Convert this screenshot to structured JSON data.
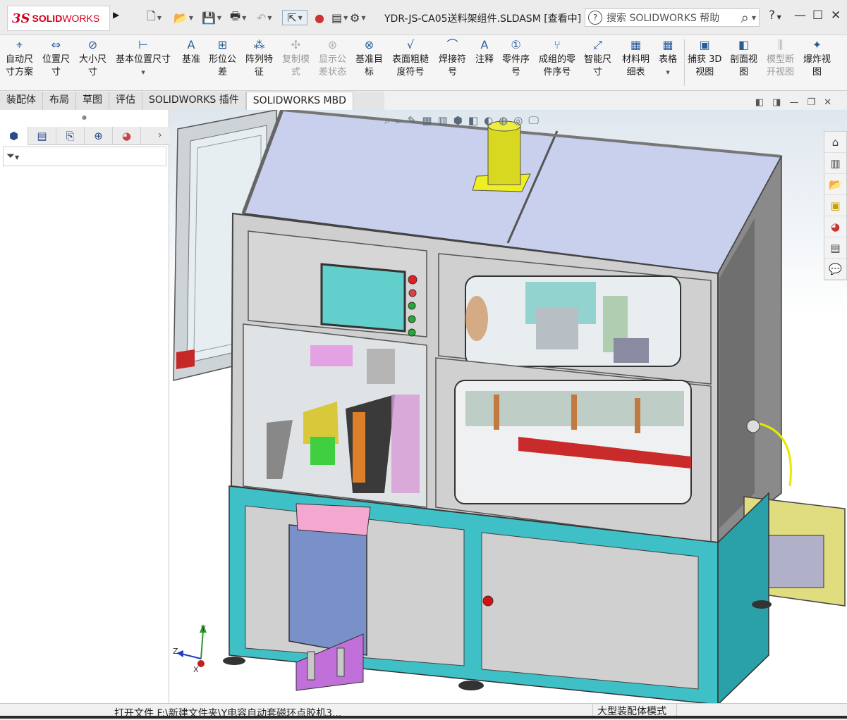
{
  "title": {
    "logo_ds": "3S",
    "logo_solid": "SOLID",
    "logo_works": "WORKS",
    "document": "YDR-JS-CA05送料架组件.SLDASM [查看中]",
    "search_placeholder": "搜索 SOLIDWORKS 帮助",
    "help_label": "?"
  },
  "commands": [
    {
      "label1": "自动尺",
      "label2": "寸方案",
      "icon": "auto-dimension-icon",
      "disabled": false
    },
    {
      "label1": "位置尺",
      "label2": "寸",
      "icon": "location-dimension-icon",
      "disabled": false
    },
    {
      "label1": "大小尺",
      "label2": "寸",
      "icon": "size-dimension-icon",
      "disabled": false
    },
    {
      "label1": "基本位置尺寸",
      "label2": "",
      "icon": "basic-location-dimension-icon",
      "disabled": false
    },
    {
      "label1": "基准",
      "label2": "",
      "icon": "datum-icon",
      "disabled": false
    },
    {
      "label1": "形位公",
      "label2": "差",
      "icon": "geometric-tolerance-icon",
      "disabled": false
    },
    {
      "label1": "阵列特",
      "label2": "征",
      "icon": "pattern-feature-icon",
      "disabled": false
    },
    {
      "label1": "复制模",
      "label2": "式",
      "icon": "copy-scheme-icon",
      "disabled": true
    },
    {
      "label1": "显示公",
      "label2": "差状态",
      "icon": "show-tolerance-status-icon",
      "disabled": true
    },
    {
      "label1": "基准目",
      "label2": "标",
      "icon": "datum-target-icon",
      "disabled": false
    },
    {
      "label1": "表面粗糙",
      "label2": "度符号",
      "icon": "surface-finish-icon",
      "disabled": false
    },
    {
      "label1": "焊接符",
      "label2": "号",
      "icon": "weld-symbol-icon",
      "disabled": false
    },
    {
      "label1": "注释",
      "label2": "",
      "icon": "note-icon",
      "disabled": false
    },
    {
      "label1": "零件序",
      "label2": "号",
      "icon": "balloon-icon",
      "disabled": false
    },
    {
      "label1": "成组的零",
      "label2": "件序号",
      "icon": "stacked-balloon-icon",
      "disabled": false
    },
    {
      "label1": "智能尺",
      "label2": "寸",
      "icon": "smart-dimension-icon",
      "disabled": false
    },
    {
      "label1": "材料明",
      "label2": "细表",
      "icon": "bom-icon",
      "disabled": false
    },
    {
      "label1": "表格",
      "label2": "",
      "icon": "table-icon",
      "disabled": false
    },
    {
      "label1": "捕获 3D",
      "label2": "视图",
      "icon": "capture-3d-view-icon",
      "disabled": false
    },
    {
      "label1": "剖面视",
      "label2": "图",
      "icon": "section-view-icon",
      "disabled": false
    },
    {
      "label1": "模型断",
      "label2": "开视图",
      "icon": "model-break-view-icon",
      "disabled": true
    },
    {
      "label1": "爆炸视",
      "label2": "图",
      "icon": "exploded-view-icon",
      "disabled": false
    }
  ],
  "tabs": [
    "装配体",
    "布局",
    "草图",
    "评估",
    "SOLIDWORKS 插件",
    "SOLIDWORKS MBD"
  ],
  "active_tab": "SOLIDWORKS MBD",
  "status": {
    "text": "打开文件 F:\\新建文件夹\\Y电容自动套磁环点胶机3...",
    "mode": "大型装配体模式"
  },
  "triad": {
    "x": "X",
    "y": "Y",
    "z": "Z"
  },
  "colors": {
    "frame_cyan": "#3fbfc6",
    "panel_grey": "#c9c9c9",
    "top_lavender": "#c9d0ee",
    "cylinder_yellow": "#e8e830",
    "screen_teal": "#63cfcc",
    "solidworks_red": "#d4001a"
  }
}
